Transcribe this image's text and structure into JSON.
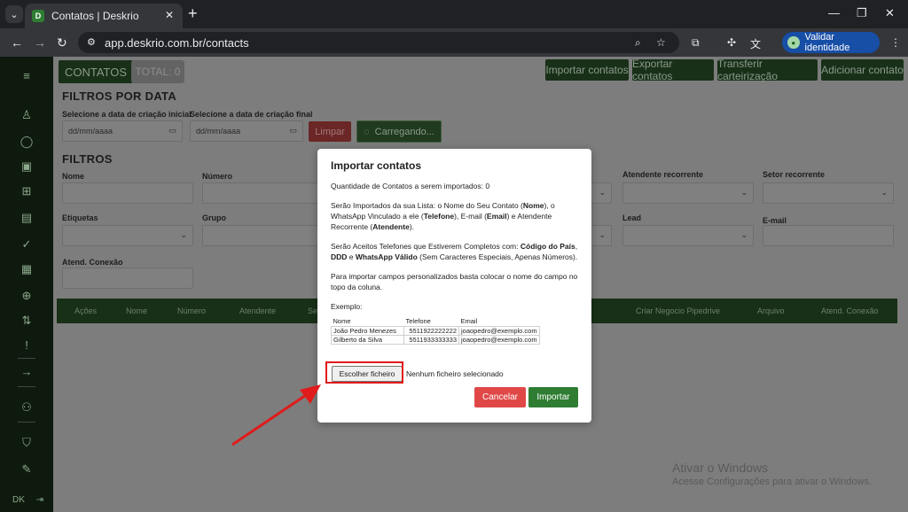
{
  "browser": {
    "tab_title": "Contatos | Deskrio",
    "tab_favicon": "D",
    "url": "app.deskrio.com.br/contacts",
    "validar_label": "Validar identidade"
  },
  "header": {
    "contatos_label": "CONTATOS",
    "total_label": "TOTAL: 0",
    "actions": [
      "Importar contatos",
      "Exportar contatos",
      "Transferir carteirização",
      "Adicionar contato"
    ]
  },
  "date_filters": {
    "title": "FILTROS POR DATA",
    "start_label": "Selecione a data de criação inicial",
    "end_label": "Selecione a data de criação final",
    "start_placeholder": "dd/mm/aaaa",
    "end_placeholder": "dd/mm/aaaa",
    "clear_label": "Limpar",
    "loading_label": "Carregando..."
  },
  "filters": {
    "title": "FILTROS",
    "nome": "Nome",
    "numero": "Número",
    "atendente_recorrente": "Atendente recorrente",
    "setor_recorrente": "Setor recorrente",
    "etiquetas": "Etiquetas",
    "grupo": "Grupo",
    "lead": "Lead",
    "email": "E-mail",
    "atend_conexao": "Atend. Conexão"
  },
  "table_headers": [
    "Ações",
    "Nome",
    "Número",
    "Atendente",
    "Se",
    "Criar Negocio Pipedrive",
    "Arquivo",
    "Atend. Conexão"
  ],
  "sidebar": {
    "footer": "DK"
  },
  "modal": {
    "title": "Importar contatos",
    "count_text": "Quantidade de Contatos a serem importados: 0",
    "p2_a": "Serão Importados da sua Lista: o Nome do Seu Contato (",
    "p2_nome": "Nome",
    "p2_b": "), o WhatsApp Vinculado a ele (",
    "p2_tel": "Telefone",
    "p2_c": "), E-mail (",
    "p2_email": "Email",
    "p2_d": ") e Atendente Recorrente (",
    "p2_at": "Atendente",
    "p2_e": ").",
    "p3_a": "Serão Aceitos Telefones que Estiverem Completos com: ",
    "p3_b": "Código do País",
    "p3_c": ", ",
    "p3_d": "DDD",
    "p3_e": " e ",
    "p3_f": "WhatsApp Válido",
    "p3_g": " (Sem Caracteres Especiais, Apenas Números).",
    "p4": "Para importar campos personalizados basta colocar o nome do campo no topo da coluna.",
    "example_label": "Exemplo:",
    "example_headers": [
      "Nome",
      "Telefone",
      "Email"
    ],
    "example_rows": [
      [
        "João Pedro Menezes",
        "5511922222222",
        "joaopedro@exemplo.com"
      ],
      [
        "Gilberto da Silva",
        "5511933333333",
        "joaopedro@exemplo.com"
      ]
    ],
    "file_button": "Escolher ficheiro",
    "file_status": "Nenhum ficheiro selecionado",
    "cancel": "Cancelar",
    "import": "Importar"
  },
  "watermark": {
    "line1": "Ativar o Windows",
    "line2": "Acesse Configurações para ativar o Windows."
  },
  "colors": {
    "accent": "#2e7d32",
    "danger": "#e04848",
    "highlight": "#e01b1b"
  }
}
